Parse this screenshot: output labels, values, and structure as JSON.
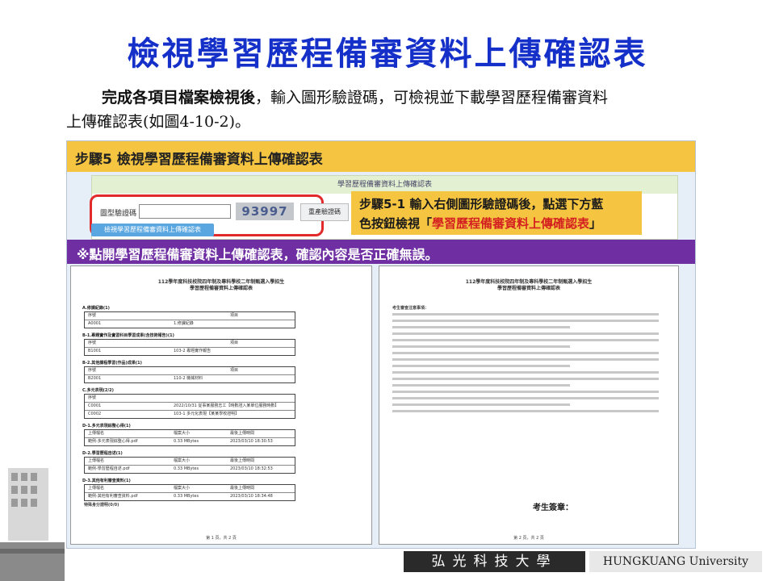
{
  "slide": {
    "title": "檢視學習歷程備審資料上傳確認表",
    "intro_bold": "完成各項目檔案檢視後",
    "intro_rest": "，輸入圖形驗證碼，可檢視並下載學習歷程備審資料",
    "intro_line2": "上傳確認表(如圖4-10-2)。"
  },
  "screenshot": {
    "step_header": "步驟5 檢視學習歷程備審資料上傳確認表",
    "panel_title": "學習歷程備審資料上傳確認表",
    "captcha_label": "圖型驗證碼",
    "captcha_value": "",
    "captcha_code": "93997",
    "refresh_button": "重產驗證碼",
    "view_button": "檢視學習歷程備審資料上傳確認表",
    "callout_line1": "步驟5-1 輸入右側圖形驗證碼後，點選下方藍",
    "callout_prefix": "色按鈕檢視「",
    "callout_highlight": "學習歷程備審資料上傳確認表",
    "callout_suffix": "」",
    "purple_bar": "※點開學習歷程備審資料上傳確認表，確認內容是否正確無誤。",
    "left_doc": {
      "title1": "112學年度科技校院四年制及專科學校二年制甄選入學招生",
      "title2": "學習歷程備審資料上傳確認表",
      "sign_label": "",
      "sections": [
        {
          "label": "A.修課紀錄(1)",
          "rows": [
            [
              "序號",
              "",
              "項目"
            ],
            [
              "A0001",
              "1.修課紀錄",
              ""
            ]
          ]
        },
        {
          "label": "B-1.專題實作及實習科目學習成果(含技術報告)(1)",
          "rows": [
            [
              "序號",
              "",
              "項目"
            ],
            [
              "B1001",
              "103-2 專題實作報告",
              ""
            ]
          ]
        },
        {
          "label": "B-2.其他課程學習(作品)成果(1)",
          "rows": [
            [
              "序號",
              "",
              "項目"
            ],
            [
              "B2001",
              "110-2 機械材料",
              ""
            ]
          ]
        },
        {
          "label": "C.多元表現(2/2)",
          "rows": [
            [
              "序號",
              "",
              ""
            ],
            [
              "C0001",
              "2022/10/31 從事某服務志工【時數證入某單位服務時數】",
              ""
            ],
            [
              "C0002",
              "103-1 多元化表現【某某學校證明】",
              ""
            ]
          ]
        },
        {
          "label": "D-1.多元表現綜整心得(1)",
          "rows": [
            [
              "上傳檔名",
              "檔案大小",
              "最後上傳時間"
            ],
            [
              "範例-多元表現綜整心得.pdf",
              "0.33 MBytes",
              "2023/03/10 18:30:53"
            ]
          ]
        },
        {
          "label": "D-2.學習歷程自述(1)",
          "rows": [
            [
              "上傳檔名",
              "檔案大小",
              "最後上傳時間"
            ],
            [
              "範例-學習歷程自述.pdf",
              "0.33 MBytes",
              "2023/03/10 18:32:53"
            ]
          ]
        },
        {
          "label": "D-3.其他有利審查資料(1)",
          "rows": [
            [
              "上傳檔名",
              "檔案大小",
              "最後上傳時間"
            ],
            [
              "範例-其他有利審查資料.pdf",
              "0.33 MBytes",
              "2023/03/10 18:34:48"
            ]
          ]
        }
      ],
      "footer_note": "特殊身分證明(0/0)",
      "page": "第 1 頁，共 2 頁"
    },
    "right_doc": {
      "title1": "112學年度科技校院四年制及專科學校二年制甄選入學招生",
      "title2": "學習歷程備審資料上傳確認表",
      "notes_title": "考生審查注意事項：",
      "signature": "考生簽章：",
      "page": "第 2 頁，共 2 頁"
    }
  },
  "university": {
    "name_cn": "弘光科技大學",
    "name_en": "HUNGKUANG University"
  },
  "colors": {
    "title": "#1530c8",
    "step_header": "#f5c542",
    "purple_bar": "#6f2fa3",
    "highlight_border": "#e22a2a",
    "view_button": "#5aa6e0"
  }
}
